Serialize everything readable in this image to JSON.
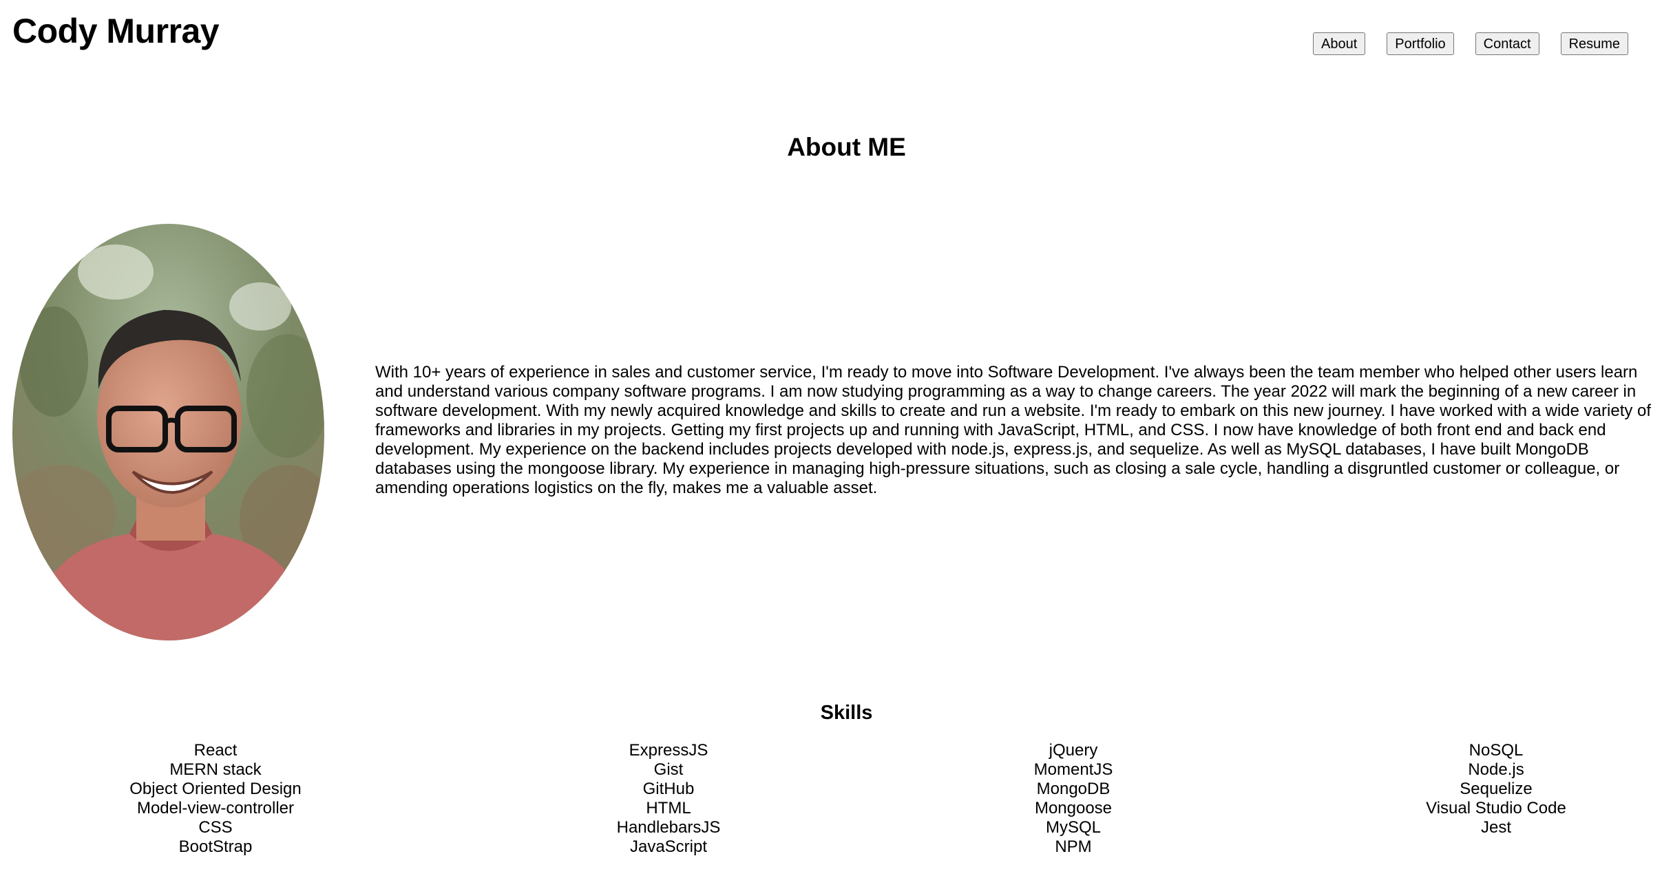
{
  "header": {
    "title": "Cody Murray",
    "nav": [
      "About",
      "Portfolio",
      "Contact",
      "Resume"
    ]
  },
  "about": {
    "title": "About ME",
    "bio": "With 10+ years of experience in sales and customer service, I'm ready to move into Software Development. I've always been the team member who helped other users learn and understand various company software programs. I am now studying programming as a way to change careers. The year 2022 will mark the beginning of a new career in software development. With my newly acquired knowledge and skills to create and run a website. I'm ready to embark on this new journey. I have worked with a wide variety of frameworks and libraries in my projects. Getting my first projects up and running with JavaScript, HTML, and CSS. I now have knowledge of both front end and back end development. My experience on the backend includes projects developed with node.js, express.js, and sequelize. As well as MySQL databases, I have built MongoDB databases using the mongoose library. My experience in managing high-pressure situations, such as closing a sale cycle, handling a disgruntled customer or colleague, or amending operations logistics on the fly, makes me a valuable asset."
  },
  "skills": {
    "title": "Skills",
    "columns": [
      [
        "React",
        "MERN stack",
        "Object Oriented Design",
        "Model-view-controller",
        "CSS",
        "BootStrap"
      ],
      [
        "ExpressJS",
        "Gist",
        "GitHub",
        "HTML",
        "HandlebarsJS",
        "JavaScript"
      ],
      [
        "jQuery",
        "MomentJS",
        "MongoDB",
        "Mongoose",
        "MySQL",
        "NPM"
      ],
      [
        "NoSQL",
        "Node.js",
        "Sequelize",
        "Visual Studio Code",
        "Jest"
      ]
    ]
  }
}
